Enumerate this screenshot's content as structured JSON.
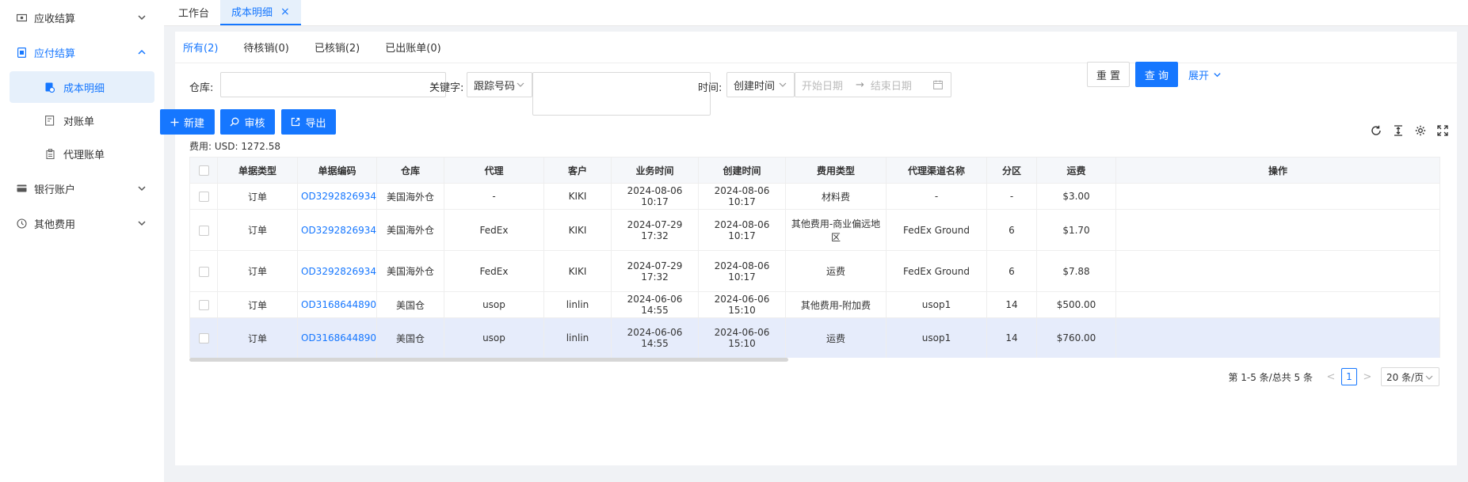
{
  "sidebar": {
    "groups": [
      {
        "label": "应收结算",
        "icon": "receivable-icon",
        "expanded": false
      },
      {
        "label": "应付结算",
        "icon": "payable-icon",
        "expanded": true,
        "items": [
          {
            "label": "成本明细",
            "icon": "cost-detail-icon",
            "selected": true
          },
          {
            "label": "对账单",
            "icon": "statement-icon",
            "selected": false
          },
          {
            "label": "代理账单",
            "icon": "agent-bill-icon",
            "selected": false
          }
        ]
      },
      {
        "label": "银行账户",
        "icon": "bank-card-icon",
        "expanded": false
      },
      {
        "label": "其他费用",
        "icon": "other-fee-icon",
        "expanded": false
      }
    ]
  },
  "window_tabs": [
    {
      "label": "工作台",
      "active": false
    },
    {
      "label": "成本明细",
      "active": true,
      "closable": true
    }
  ],
  "status_tabs": [
    {
      "label": "所有(2)",
      "active": true
    },
    {
      "label": "待核销(0)",
      "active": false
    },
    {
      "label": "已核销(2)",
      "active": false
    },
    {
      "label": "已出账单(0)",
      "active": false
    }
  ],
  "filters": {
    "warehouse_label": "仓库:",
    "warehouse_value": "",
    "keyword_label": "关键字:",
    "keyword_type": "跟踪号码",
    "keyword_value": "",
    "time_label": "时间:",
    "time_type": "创建时间",
    "start_placeholder": "开始日期",
    "end_placeholder": "结束日期",
    "reset": "重 置",
    "query": "查 询",
    "expand": "展开"
  },
  "actions": {
    "new": "新建",
    "audit": "审核",
    "export": "导出"
  },
  "fee_summary": "费用: USD: 1272.58",
  "table": {
    "columns": [
      "单据类型",
      "单据编码",
      "仓库",
      "代理",
      "客户",
      "业务时间",
      "创建时间",
      "费用类型",
      "代理渠道名称",
      "分区",
      "运费",
      "操作"
    ],
    "rows": [
      [
        "订单",
        "OD3292826934",
        "美国海外仓",
        "-",
        "KIKI",
        "2024-08-06 10:17",
        "2024-08-06 10:17",
        "材料费",
        "-",
        "-",
        "$3.00",
        ""
      ],
      [
        "订单",
        "OD3292826934",
        "美国海外仓",
        "FedEx",
        "KIKI",
        "2024-07-29 17:32",
        "2024-08-06 10:17",
        "其他费用-商业偏远地区",
        "FedEx Ground",
        "6",
        "$1.70",
        ""
      ],
      [
        "订单",
        "OD3292826934",
        "美国海外仓",
        "FedEx",
        "KIKI",
        "2024-07-29 17:32",
        "2024-08-06 10:17",
        "运费",
        "FedEx Ground",
        "6",
        "$7.88",
        ""
      ],
      [
        "订单",
        "OD3168644890",
        "美国仓",
        "usop",
        "linlin",
        "2024-06-06 14:55",
        "2024-06-06 15:10",
        "其他费用-附加费",
        "usop1",
        "14",
        "$500.00",
        ""
      ],
      [
        "订单",
        "OD3168644890",
        "美国仓",
        "usop",
        "linlin",
        "2024-06-06 14:55",
        "2024-06-06 15:10",
        "运费",
        "usop1",
        "14",
        "$760.00",
        ""
      ]
    ],
    "highlighted_row": 4
  },
  "pagination": {
    "total_text": "第 1-5 条/总共 5 条",
    "prev": "<",
    "next": ">",
    "current_page": "1",
    "page_size": "20 条/页"
  },
  "colors": {
    "primary": "#1677ff",
    "selected_bg": "#e6f0fb",
    "highlight_row": "#e6ecfb"
  }
}
